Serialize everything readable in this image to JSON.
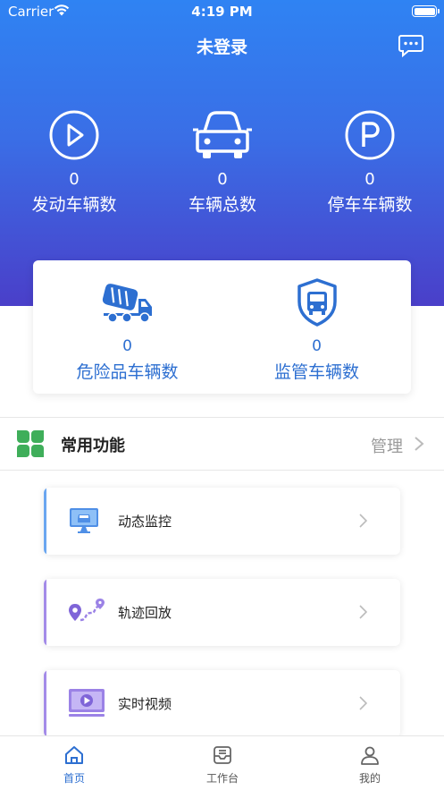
{
  "status_bar": {
    "carrier": "Carrier",
    "time": "4:19 PM"
  },
  "header": {
    "title": "未登录",
    "message_icon": "chat-bubble-icon"
  },
  "stats": [
    {
      "icon": "play-circle-icon",
      "value": "0",
      "label": "发动车辆数"
    },
    {
      "icon": "car-icon",
      "value": "0",
      "label": "车辆总数"
    },
    {
      "icon": "parking-icon",
      "value": "0",
      "label": "停车车辆数"
    }
  ],
  "card_stats": [
    {
      "icon": "cement-truck-icon",
      "value": "0",
      "label": "危险品车辆数"
    },
    {
      "icon": "shield-bus-icon",
      "value": "0",
      "label": "监管车辆数"
    }
  ],
  "section": {
    "title": "常用功能",
    "manage": "管理"
  },
  "functions": [
    {
      "icon": "monitor-icon",
      "label": "动态监控",
      "accent": "#6aa6f0"
    },
    {
      "icon": "route-pin-icon",
      "label": "轨迹回放",
      "accent": "#a38be8"
    },
    {
      "icon": "video-play-icon",
      "label": "实时视频",
      "accent": "#a38be8"
    }
  ],
  "tabs": [
    {
      "icon": "home-icon",
      "label": "首页",
      "active": true
    },
    {
      "icon": "inbox-icon",
      "label": "工作台",
      "active": false
    },
    {
      "icon": "user-icon",
      "label": "我的",
      "active": false
    }
  ],
  "colors": {
    "hero_top": "#2f83f3",
    "hero_bottom": "#4a3fc9",
    "primary": "#2d6fd1",
    "clover": "#3fae5a"
  }
}
